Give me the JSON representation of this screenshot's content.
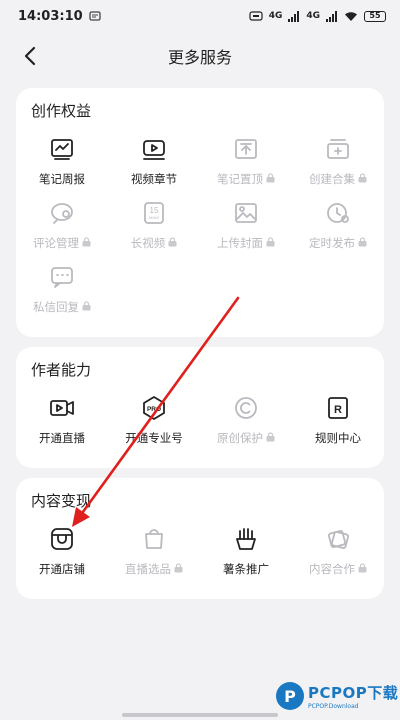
{
  "status_bar": {
    "time": "14:03:10",
    "signal_a": "4G",
    "signal_b": "4G",
    "battery": "55"
  },
  "nav": {
    "title": "更多服务"
  },
  "sections": [
    {
      "title": "创作权益",
      "items": [
        {
          "label": "笔记周报",
          "icon": "report-icon",
          "locked": false
        },
        {
          "label": "视频章节",
          "icon": "video-chapter-icon",
          "locked": false
        },
        {
          "label": "笔记置顶",
          "icon": "pin-top-icon",
          "locked": true
        },
        {
          "label": "创建合集",
          "icon": "collection-icon",
          "locked": true
        },
        {
          "label": "评论管理",
          "icon": "comment-manage-icon",
          "locked": true
        },
        {
          "label": "长视频",
          "icon": "long-video-icon",
          "locked": true
        },
        {
          "label": "上传封面",
          "icon": "cover-upload-icon",
          "locked": true
        },
        {
          "label": "定时发布",
          "icon": "scheduled-publish-icon",
          "locked": true
        },
        {
          "label": "私信回复",
          "icon": "message-reply-icon",
          "locked": true
        }
      ]
    },
    {
      "title": "作者能力",
      "items": [
        {
          "label": "开通直播",
          "icon": "live-stream-icon",
          "locked": false
        },
        {
          "label": "开通专业号",
          "icon": "pro-account-icon",
          "locked": false
        },
        {
          "label": "原创保护",
          "icon": "copyright-icon",
          "locked": true
        },
        {
          "label": "规则中心",
          "icon": "rules-icon",
          "locked": false
        }
      ]
    },
    {
      "title": "内容变现",
      "items": [
        {
          "label": "开通店铺",
          "icon": "store-icon",
          "locked": false
        },
        {
          "label": "直播选品",
          "icon": "shopping-bag-icon",
          "locked": true
        },
        {
          "label": "薯条推广",
          "icon": "fries-promo-icon",
          "locked": false
        },
        {
          "label": "内容合作",
          "icon": "cooperation-icon",
          "locked": true
        }
      ]
    }
  ],
  "watermark": {
    "logo": "P",
    "text": "PCPOP下载",
    "sub": "PCPOP.Download"
  },
  "annotation_color": "#e0201c"
}
